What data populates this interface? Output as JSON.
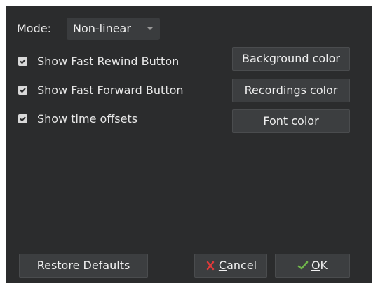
{
  "mode": {
    "label": "Mode:",
    "value": "Non-linear"
  },
  "options": [
    {
      "label": "Show Fast Rewind Button",
      "checked": true
    },
    {
      "label": "Show Fast Forward Button",
      "checked": true
    },
    {
      "label": "Show time offsets",
      "checked": true
    }
  ],
  "color_buttons": {
    "background": "Background color",
    "recordings": "Recordings color",
    "font": "Font color"
  },
  "footer": {
    "restore": "Restore Defaults",
    "cancel_prefix": "",
    "cancel_accel": "C",
    "cancel_rest": "ancel",
    "ok_accel": "O",
    "ok_rest": "K"
  },
  "icons": {
    "cancel": "x-icon",
    "ok": "checkmark-icon"
  },
  "colors": {
    "dialog_bg": "#2b2c2d",
    "button_bg": "#3c3e40",
    "cancel_icon": "#e03a3a",
    "ok_icon": "#6fb54a"
  }
}
